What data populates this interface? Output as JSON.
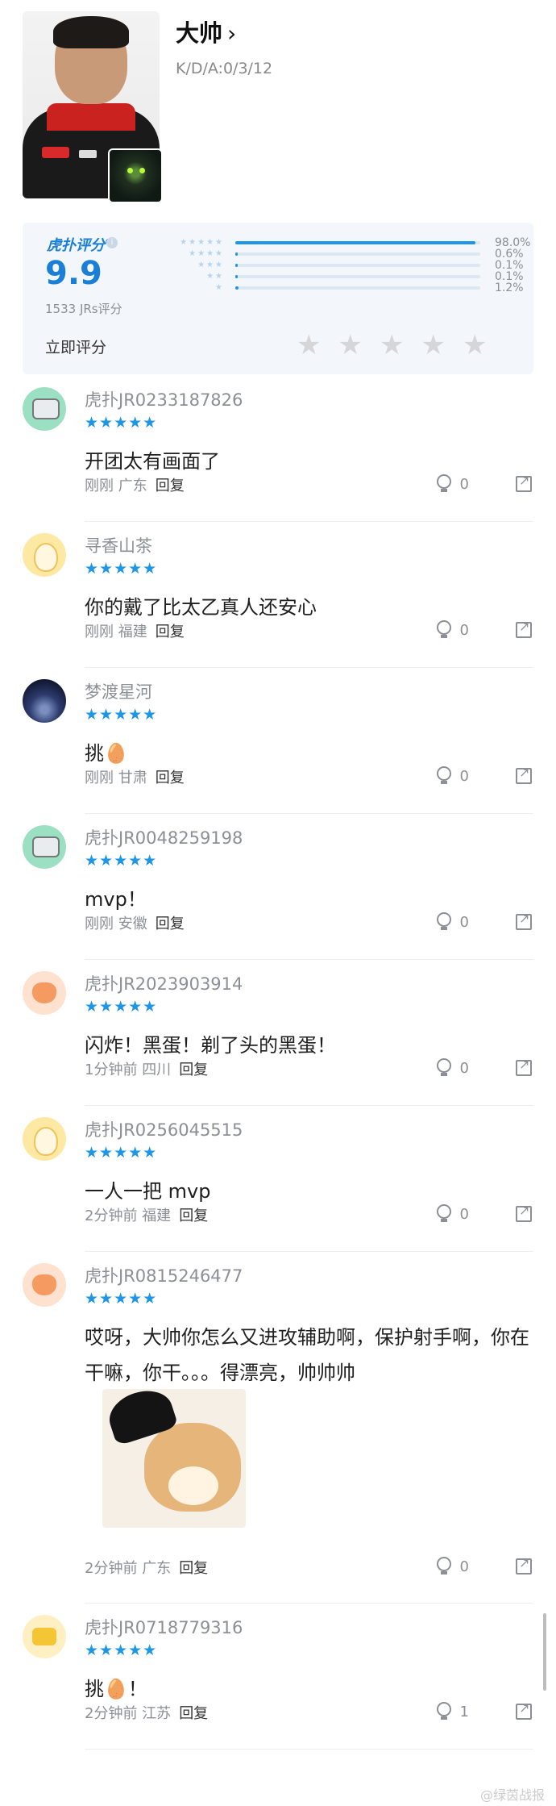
{
  "player": {
    "name": "大帅",
    "chevron": "›",
    "kda": "K/D/A:0/3/12"
  },
  "rating": {
    "brand": "虎扑评分",
    "brand_mark": "®",
    "info_icon": "i",
    "score": "9.9",
    "count_text": "1533 JRs评分",
    "distribution": [
      {
        "stars": "★★★★★",
        "percent": "98.0%",
        "fraction": 0.98
      },
      {
        "stars": "★★★★",
        "percent": "0.6%",
        "fraction": 0.006
      },
      {
        "stars": "★★★",
        "percent": "0.1%",
        "fraction": 0.001
      },
      {
        "stars": "★★",
        "percent": "0.1%",
        "fraction": 0.001
      },
      {
        "stars": "★",
        "percent": "1.2%",
        "fraction": 0.012
      }
    ],
    "rate_now_label": "立即评分",
    "rate_star": "★",
    "accent_color": "#1e96e6"
  },
  "comments": [
    {
      "user": "虎扑JR0233187826",
      "stars": "★★★★★",
      "text": "开团太有画面了",
      "time": "刚刚",
      "location": "广东",
      "reply": "回复",
      "likes": "0",
      "avatar": "robot-avatar"
    },
    {
      "user": "寻香山茶",
      "stars": "★★★★★",
      "text": "你的戴了比太乙真人还安心",
      "time": "刚刚",
      "location": "福建",
      "reply": "回复",
      "likes": "0",
      "avatar": "egg-avatar"
    },
    {
      "user": "梦渡星河",
      "stars": "★★★★★",
      "text": "挑🥚",
      "time": "刚刚",
      "location": "甘肃",
      "reply": "回复",
      "likes": "0",
      "avatar": "space-avatar"
    },
    {
      "user": "虎扑JR0048259198",
      "stars": "★★★★★",
      "text": "mvp！",
      "time": "刚刚",
      "location": "安徽",
      "reply": "回复",
      "likes": "0",
      "avatar": "robot-avatar"
    },
    {
      "user": "虎扑JR2023903914",
      "stars": "★★★★★",
      "text": "闪炸！黑蛋！剃了头的黑蛋！",
      "time": "1分钟前",
      "location": "四川",
      "reply": "回复",
      "likes": "0",
      "avatar": "cat-avatar"
    },
    {
      "user": "虎扑JR0256045515",
      "stars": "★★★★★",
      "text": "一人一把 mvp",
      "time": "2分钟前",
      "location": "福建",
      "reply": "回复",
      "likes": "0",
      "avatar": "egg-avatar"
    },
    {
      "user": "虎扑JR0815246477",
      "stars": "★★★★★",
      "text": "哎呀，大帅你怎么又进攻辅助啊，保护射手啊，你在干嘛，你干。。。得漂亮，帅帅帅",
      "time": "2分钟前",
      "location": "广东",
      "reply": "回复",
      "likes": "0",
      "avatar": "cat-avatar",
      "image": "doge-with-hat-meme"
    },
    {
      "user": "虎扑JR0718779316",
      "stars": "★★★★★",
      "text": "挑🥚！",
      "time": "2分钟前",
      "location": "江苏",
      "reply": "回复",
      "likes": "1",
      "avatar": "gold-avatar"
    }
  ],
  "watermark": "@绿茵战报"
}
